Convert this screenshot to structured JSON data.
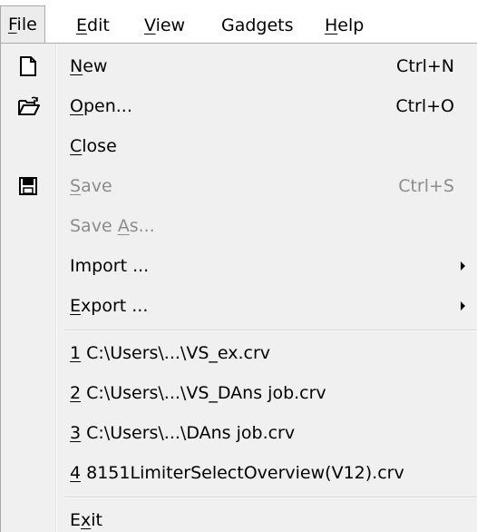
{
  "menubar": {
    "items": [
      {
        "label": "File",
        "mnemonic": "F",
        "rest": "ile",
        "active": true
      },
      {
        "label": "Edit",
        "mnemonic": "E",
        "rest": "dit"
      },
      {
        "label": "View",
        "mnemonic": "V",
        "rest": "iew"
      },
      {
        "label": "Gadgets",
        "mnemonic": "",
        "rest": "Gadgets"
      },
      {
        "label": "Help",
        "mnemonic": "H",
        "rest": "elp"
      }
    ]
  },
  "file_menu": {
    "new": {
      "pre": "",
      "mnemonic": "N",
      "rest": "ew",
      "shortcut": "Ctrl+N",
      "icon": "new-document-icon"
    },
    "open": {
      "pre": "",
      "mnemonic": "O",
      "rest": "pen...",
      "shortcut": "Ctrl+O",
      "icon": "open-folder-icon"
    },
    "close": {
      "pre": "",
      "mnemonic": "C",
      "rest": "lose"
    },
    "save": {
      "pre": "",
      "mnemonic": "S",
      "rest": "ave",
      "shortcut": "Ctrl+S",
      "icon": "floppy-disk-icon",
      "disabled": true
    },
    "save_as": {
      "pre": "Save ",
      "mnemonic": "A",
      "rest": "s...",
      "disabled": true
    },
    "import": {
      "label": "Import ...",
      "submenu": true
    },
    "export": {
      "pre": "",
      "mnemonic": "E",
      "rest": "xport ...",
      "submenu": true
    },
    "recent": [
      {
        "mnemonic": "1",
        "rest": " C:\\Users\\...\\VS_ex.crv"
      },
      {
        "mnemonic": "2",
        "rest": " C:\\Users\\...\\VS_DAns job.crv"
      },
      {
        "mnemonic": "3",
        "rest": " C:\\Users\\...\\DAns job.crv"
      },
      {
        "mnemonic": "4",
        "rest": " 8151LimiterSelectOverview(V12).crv"
      }
    ],
    "exit": {
      "pre": "E",
      "mnemonic": "x",
      "rest": "it"
    }
  },
  "colors": {
    "menu_background": "#f0f0f0",
    "disabled_text": "#8c8c8c",
    "active_menubar_bg": "#ececec"
  }
}
